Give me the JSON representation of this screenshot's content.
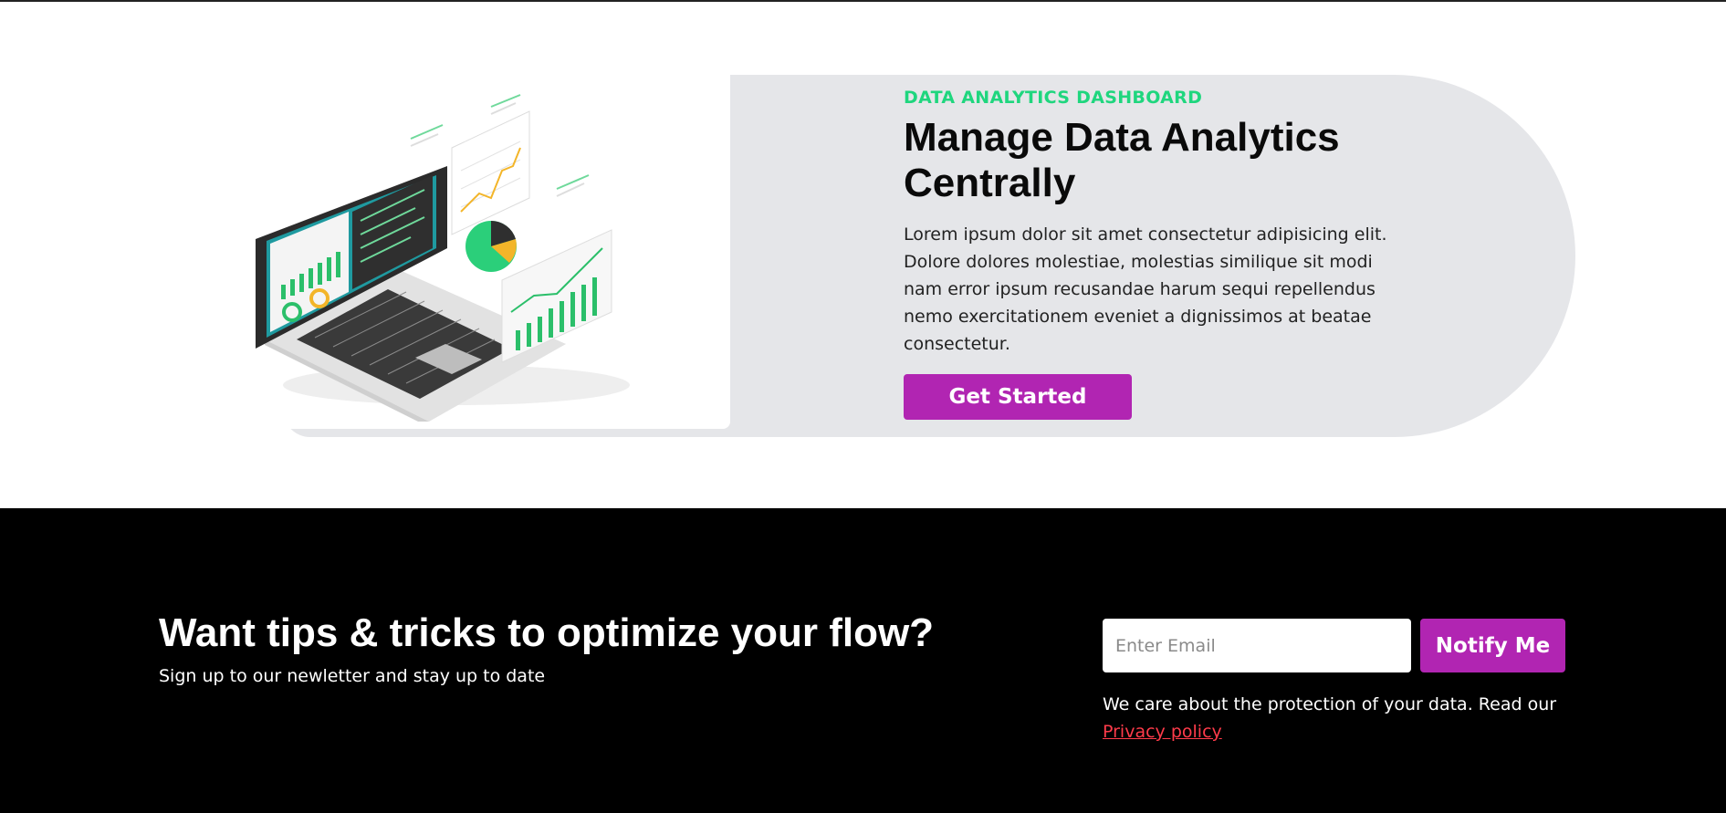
{
  "hero": {
    "eyebrow": "DATA ANALYTICS DASHBOARD",
    "title": "Manage Data Analytics Centrally",
    "description": "Lorem ipsum dolor sit amet consectetur adipisicing elit. Dolore dolores molestiae, molestias similique sit modi nam error ipsum recusandae harum sequi repellendus nemo exercitationem eveniet a dignissimos at beatae consectetur.",
    "cta_label": "Get Started",
    "illustration_icon": "laptop-analytics-illustration"
  },
  "newsletter": {
    "title": "Want tips & tricks to optimize your flow?",
    "subtitle": "Sign up to our newletter and stay up to date",
    "email_placeholder": "Enter Email",
    "email_value": "",
    "notify_label": "Notify Me",
    "privacy_text": "We care about the protection of your data. Read our",
    "privacy_link": "Privacy policy"
  },
  "colors": {
    "accent_purple": "#b125b2",
    "accent_green": "#1fd67e",
    "link_red": "#ff3b4a",
    "pill_gray": "#e5e6e9",
    "footer_black": "#000000"
  }
}
